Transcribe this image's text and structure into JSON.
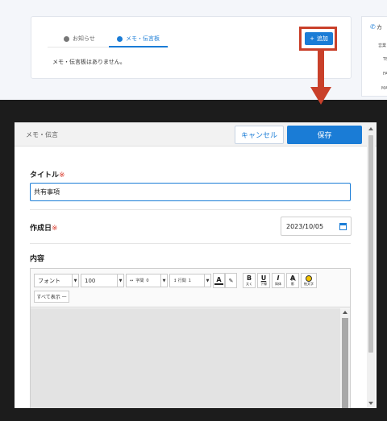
{
  "top": {
    "tabs": [
      {
        "label": "お知らせ",
        "icon": "info-icon"
      },
      {
        "label": "メモ・伝言板",
        "icon": "speech-bubble-icon"
      }
    ],
    "empty_message": "メモ・伝言板はありません。",
    "add_button": "追加",
    "side_card": {
      "title": "カ",
      "rows": [
        "営業",
        "TE",
        "FA",
        "MA"
      ]
    }
  },
  "modal": {
    "title": "メモ・伝言",
    "cancel_label": "キャンセル",
    "save_label": "保存",
    "title_label": "タイトル",
    "title_value": "共有事項",
    "date_label": "作成日",
    "date_value": "2023/10/05",
    "content_label": "内容",
    "required_mark": "※",
    "toolbar": {
      "font_select": "フォント",
      "size_select": "100",
      "spacing_label": "字間",
      "spacing_value": "0",
      "line_label": "行間",
      "line_value": "1",
      "text_color": "A",
      "bold": "B",
      "bold_caption": "太く",
      "underline": "U",
      "underline_caption": "下線",
      "italic": "I",
      "italic_caption": "斜体",
      "shadow": "A",
      "shadow_caption": "影",
      "emoji_caption": "絵文字",
      "show_all": "すべて表示"
    }
  },
  "colors": {
    "accent": "#1a7cd6",
    "highlight": "#c9402a",
    "required": "#d9382a"
  }
}
